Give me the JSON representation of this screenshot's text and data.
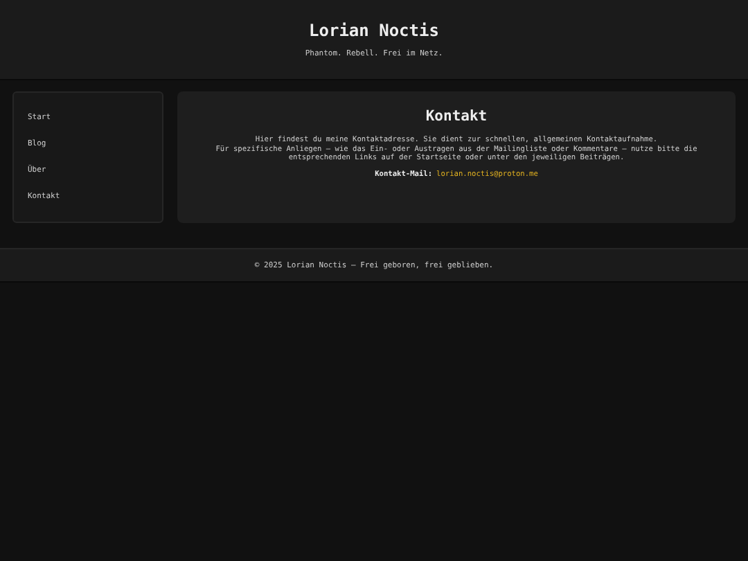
{
  "header": {
    "title": "Lorian Noctis",
    "tagline": "Phantom. Rebell. Frei im Netz."
  },
  "sidebar": {
    "items": [
      {
        "label": "Start"
      },
      {
        "label": "Blog"
      },
      {
        "label": "Über"
      },
      {
        "label": "Kontakt"
      }
    ]
  },
  "content": {
    "heading": "Kontakt",
    "paragraphs": [
      "Hier findest du meine Kontaktadresse. Sie dient zur schnellen, allgemeinen Kontaktaufnahme.",
      "Für spezifische Anliegen – wie das Ein- oder Austragen aus der Mailingliste oder Kommentare – nutze bitte die entsprechenden Links auf der Startseite oder unter den jeweiligen Beiträgen."
    ],
    "email_label": "Kontakt-Mail:",
    "email": "lorian.noctis@proton.me"
  },
  "footer": {
    "text": "© 2025 Lorian Noctis – Frei geboren, frei geblieben."
  }
}
